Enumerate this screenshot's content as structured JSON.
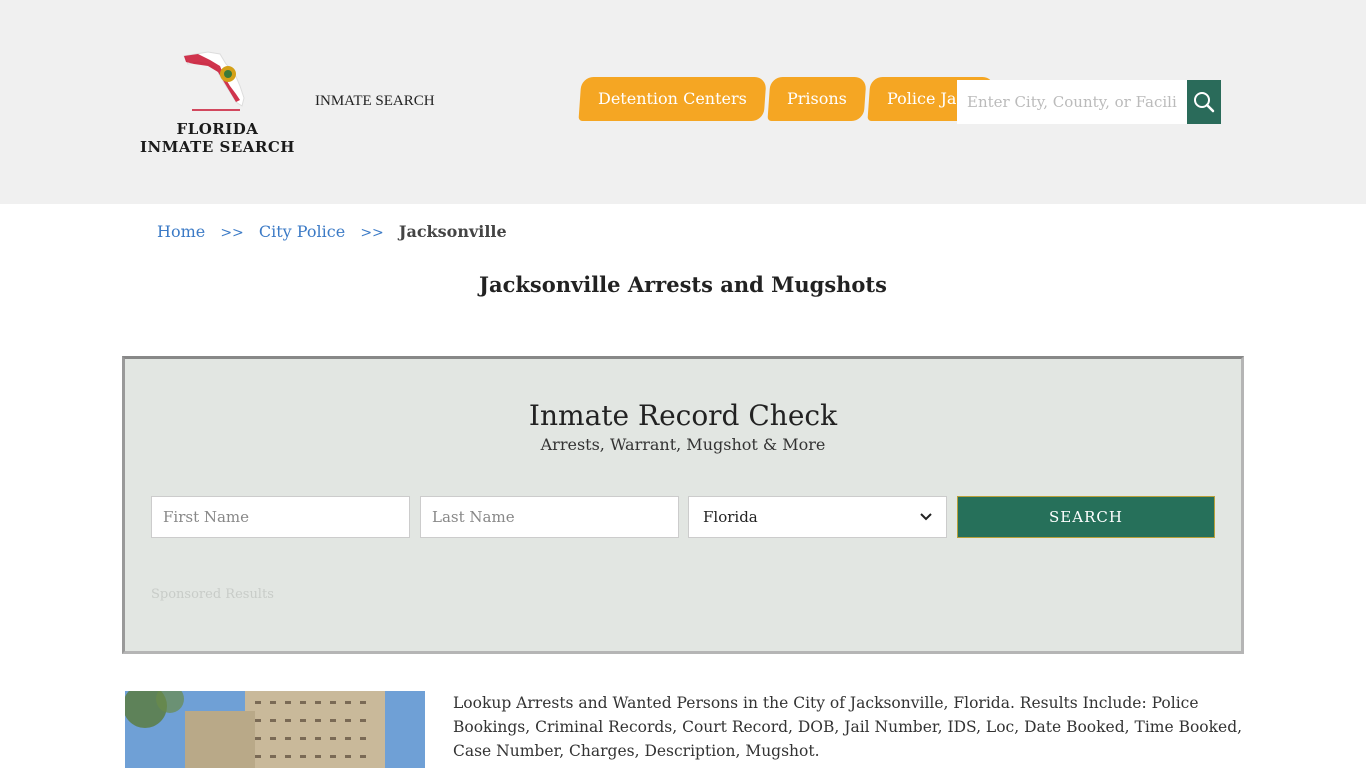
{
  "header": {
    "logo_text_line1": "FLORIDA",
    "logo_text_line2": "INMATE SEARCH",
    "site_name": "INMATE SEARCH",
    "nav": [
      {
        "label": "Detention Centers"
      },
      {
        "label": "Prisons"
      },
      {
        "label": "Police Jails"
      }
    ],
    "search": {
      "placeholder": "Enter City, County, or Facility",
      "icon": "search-icon"
    },
    "colors": {
      "nav_tab": "#f5a623",
      "search_button": "#2a6b5a",
      "header_bg": "#f0f0f0"
    }
  },
  "breadcrumb": {
    "home": "Home",
    "sep": ">>",
    "city_police": "City Police",
    "current": "Jacksonville"
  },
  "page_title": "Jacksonville Arrests and Mugshots",
  "record_check": {
    "title": "Inmate Record Check",
    "subtitle": "Arrests, Warrant, Mugshot & More",
    "first_name_placeholder": "First Name",
    "last_name_placeholder": "Last Name",
    "state_selected": "Florida",
    "search_label": "SEARCH",
    "sponsored": "Sponsored Results",
    "colors": {
      "box_bg": "#e2e6e2",
      "search_button": "#26705a"
    }
  },
  "content": {
    "description": "Lookup Arrests and Wanted Persons in the City of Jacksonville, Florida. Results Include: Police Bookings, Criminal Records, Court Record, DOB, Jail Number, IDS, Loc, Date Booked, Time Booked, Case Number, Charges, Description, Mugshot."
  }
}
